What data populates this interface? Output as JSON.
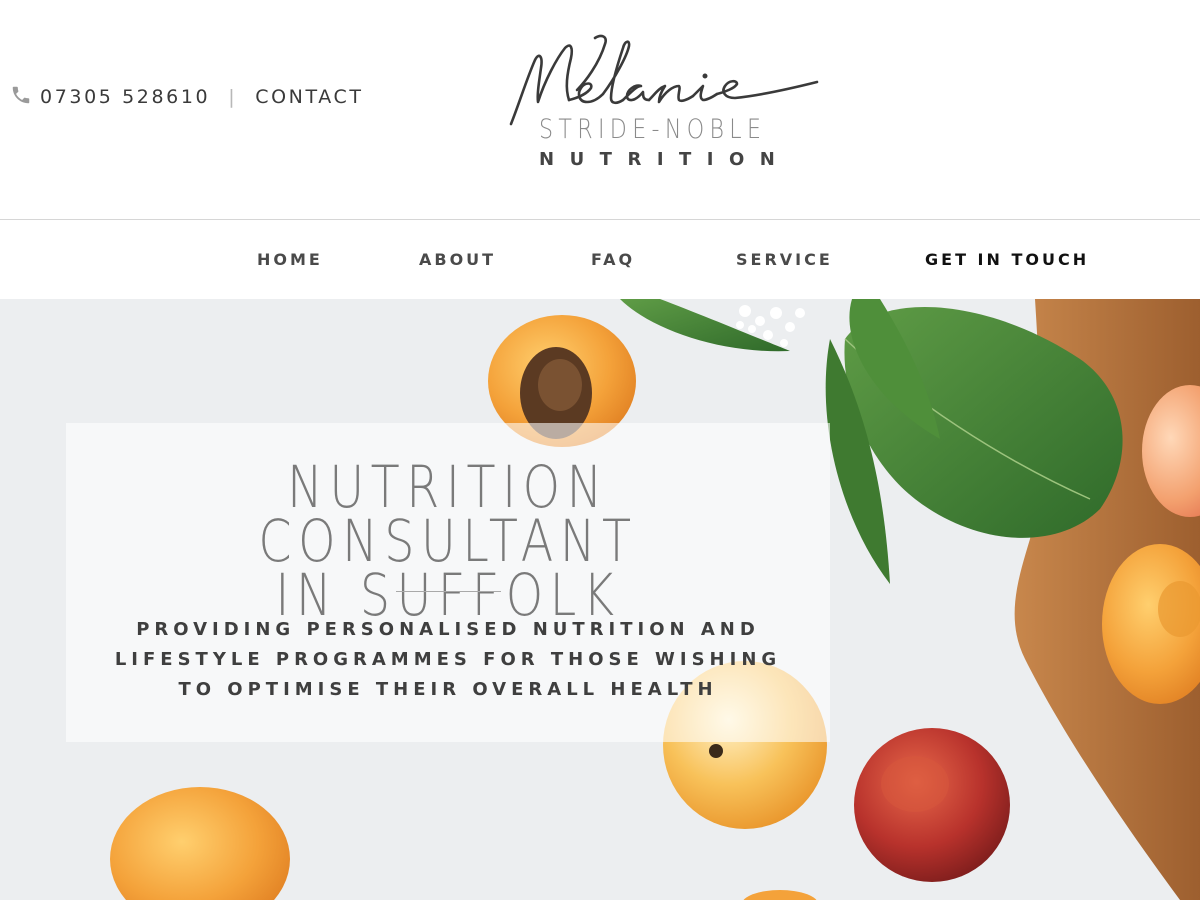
{
  "header": {
    "phone": "07305 528610",
    "separator": "|",
    "contact_label": "CONTACT",
    "phone_icon": "phone-icon"
  },
  "logo": {
    "script_name": "Melanie",
    "subtitle": "STRIDE-NOBLE",
    "tagline": "NUTRITION"
  },
  "nav": {
    "items": [
      {
        "label": "HOME"
      },
      {
        "label": "ABOUT"
      },
      {
        "label": "FAQ"
      },
      {
        "label": "SERVICE"
      },
      {
        "label": "GET IN TOUCH"
      }
    ]
  },
  "hero": {
    "title_lines": [
      "NUTRITION CONSULTANT",
      "IN SUFFOLK"
    ],
    "subtitle_lines": [
      "PROVIDING PERSONALISED NUTRITION AND",
      "LIFESTYLE PROGRAMMES FOR THOSE WISHING",
      "TO OPTIMISE THEIR OVERALL HEALTH"
    ]
  },
  "colors": {
    "text_dark": "#3a3a3a",
    "text_muted": "#7a7a7a",
    "apricot": "#f2a640",
    "leaf": "#4d8a3a",
    "board": "#b3743f"
  }
}
